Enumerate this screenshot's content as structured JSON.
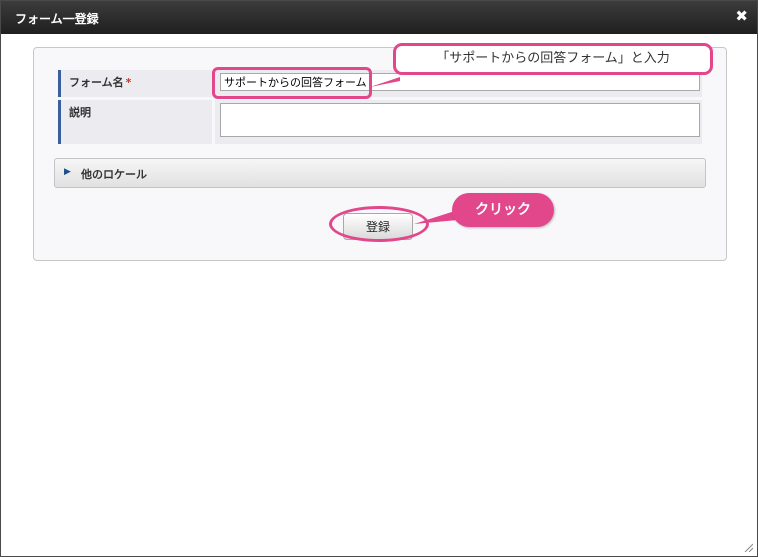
{
  "dialog": {
    "title": "フォーム一登録",
    "close_symbol": "✖"
  },
  "form": {
    "name_label": "フォーム名",
    "required_mark": "*",
    "name_value": "サポートからの回答フォーム",
    "description_label": "説明",
    "description_value": ""
  },
  "accordion": {
    "label": "他のロケール",
    "arrow": "▶"
  },
  "submit": {
    "label": "登録"
  },
  "annotations": {
    "input_callout": "「サポートからの回答フォーム」と入力",
    "click_callout": "クリック",
    "highlight_color": "#e2478b"
  },
  "colors": {
    "titlebar": "#2b2b2b",
    "label_accent": "#3a5f9c"
  }
}
